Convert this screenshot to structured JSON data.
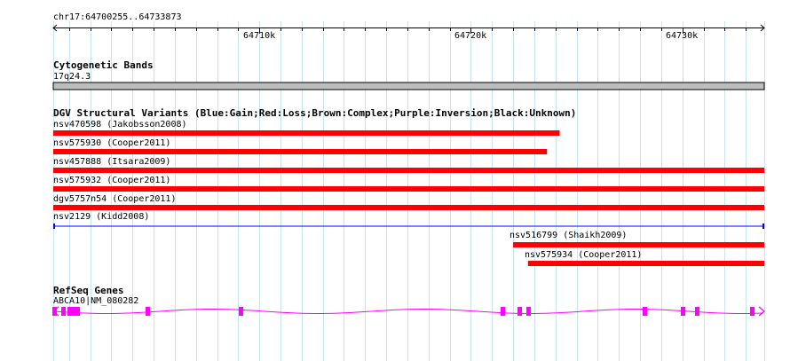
{
  "ruler": {
    "location": "chr17:64700255..64733873",
    "ticks": [
      "64710k",
      "64720k",
      "64730k"
    ]
  },
  "cytoband": {
    "title": "Cytogenetic Bands",
    "band": "17q24.3"
  },
  "dgv": {
    "title": "DGV Structural Variants (Blue:Gain;Red:Loss;Brown:Complex;Purple:Inversion;Black:Unknown)",
    "variants": [
      {
        "label": "nsv470598 (Jakobsson2008)",
        "start": 64700255,
        "end": 64724200,
        "color": "#ff0000"
      },
      {
        "label": "nsv575930 (Cooper2011)",
        "start": 64700255,
        "end": 64723600,
        "color": "#ff0000"
      },
      {
        "label": "nsv457888 (Itsara2009)",
        "start": 64700255,
        "end": 64733873,
        "color": "#ff0000"
      },
      {
        "label": "nsv575932 (Cooper2011)",
        "start": 64700255,
        "end": 64733873,
        "color": "#ff0000"
      },
      {
        "label": "dgv5757n54 (Cooper2011)",
        "start": 64700255,
        "end": 64733873,
        "color": "#ff0000"
      },
      {
        "label": "nsv2129 (Kidd2008)",
        "start": 64700255,
        "end": 64733873,
        "color": "#0000ff"
      },
      {
        "label": "nsv516799 (Shaikh2009)",
        "start": 64722000,
        "end": 64733873,
        "color": "#ff0000"
      },
      {
        "label": "nsv575934 (Cooper2011)",
        "start": 64722700,
        "end": 64733873,
        "color": "#ff0000"
      }
    ]
  },
  "refseq": {
    "title": "RefSeq Genes",
    "gene_label": "ABCA10|NM_080282",
    "color": "#ff00ff",
    "exons": [
      64700300,
      64700700,
      64701000,
      64701200,
      64701400,
      64704700,
      64709100,
      64721500,
      64722300,
      64722700,
      64728200,
      64730000,
      64730700,
      64733300
    ]
  }
}
